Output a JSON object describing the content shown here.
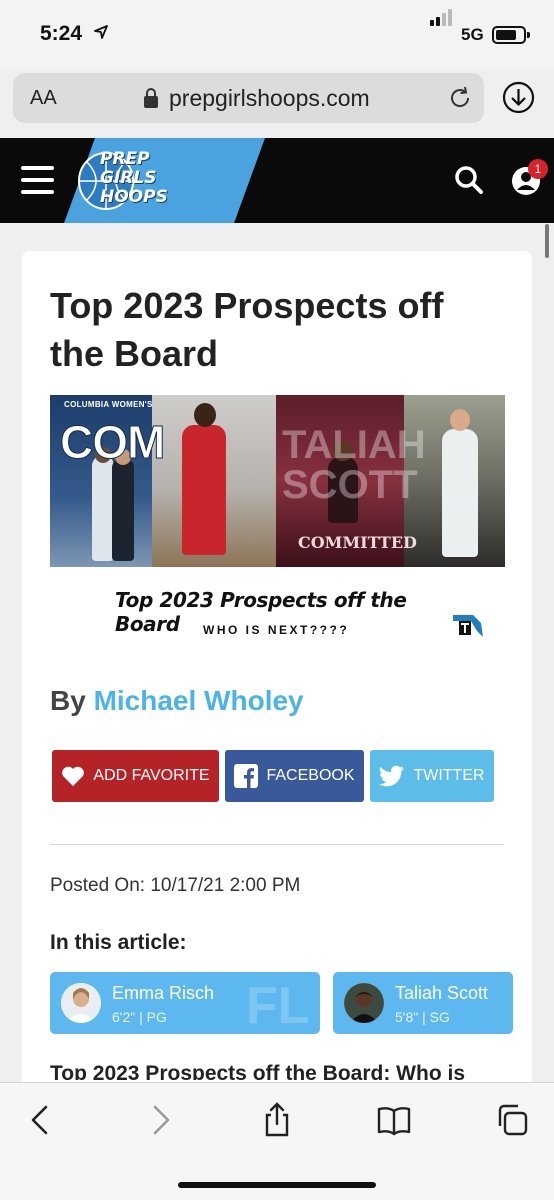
{
  "status_bar": {
    "time": "5:24",
    "network": "5G"
  },
  "browser": {
    "text_size_label": "AA",
    "url": "prepgirlshoops.com"
  },
  "site": {
    "logo_lines": [
      "PREP",
      "GIRLS",
      "HOOPS"
    ],
    "notification_count": "1",
    "brand_color": "#4aa3df"
  },
  "article": {
    "title": "Top 2023 Prospects off the Board",
    "hero": {
      "panel1_label": "COLUMBIA WOMEN'S",
      "panel1_big": "COM",
      "panel3_name": "TALIAH SCOTT",
      "panel3_stamp": "COMMITTED"
    },
    "promo_title": "Top 2023 Prospects off the Board",
    "promo_subtitle": "WHO IS NEXT????",
    "byline_prefix": "By",
    "author": "Michael Wholey",
    "buttons": {
      "favorite": "ADD FAVORITE",
      "facebook": "FACEBOOK",
      "twitter": "TWITTER"
    },
    "posted_on": "Posted On: 10/17/21 2:00 PM",
    "in_this_article": "In this article:",
    "players": [
      {
        "name": "Emma Risch",
        "meta": "6'2\" | PG",
        "state": "FL"
      },
      {
        "name": "Taliah Scott",
        "meta": "5'8\" | SG"
      }
    ],
    "body_heading": "Top 2023 Prospects off the Board: Who is"
  },
  "icons": [
    "location-arrow-icon",
    "lock-icon",
    "reload-icon",
    "download-icon",
    "menu-icon",
    "search-icon",
    "user-icon",
    "heart-icon",
    "facebook-icon",
    "twitter-icon",
    "back-icon",
    "forward-icon",
    "share-icon",
    "bookmarks-icon",
    "tabs-icon"
  ]
}
